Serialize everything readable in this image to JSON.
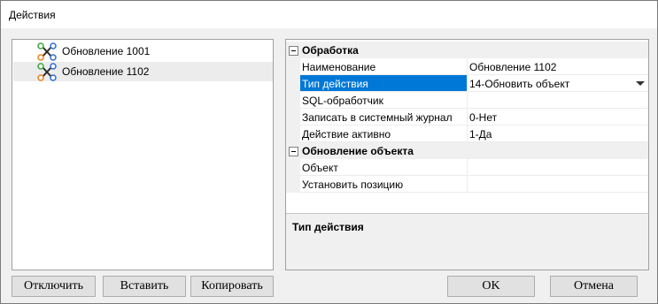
{
  "window": {
    "title": "Действия"
  },
  "tree": {
    "items": [
      {
        "label": "Обновление 1001",
        "selected": false
      },
      {
        "label": "Обновление 1102",
        "selected": true
      }
    ]
  },
  "props": {
    "categories": [
      {
        "title": "Обработка",
        "rows": [
          {
            "name": "Наименование",
            "value": "Обновление 1102"
          },
          {
            "name": "Тип действия",
            "value": "14-Обновить объект",
            "selected": true,
            "dropdown": true
          },
          {
            "name": "SQL-обработчик",
            "value": ""
          },
          {
            "name": "Записать в системный журнал",
            "value": "0-Нет"
          },
          {
            "name": "Действие активно",
            "value": "1-Да"
          }
        ]
      },
      {
        "title": "Обновление объекта",
        "rows": [
          {
            "name": "Объект",
            "value": ""
          },
          {
            "name": "Установить позицию",
            "value": ""
          }
        ]
      }
    ],
    "description_title": "Тип действия"
  },
  "buttons": {
    "disable": "Отключить",
    "insert": "Вставить",
    "copy": "Копировать",
    "ok": "OK",
    "cancel": "Отмена"
  },
  "colors": {
    "selection": "#0078d7",
    "icon_blue": "#2f6fd0",
    "icon_orange": "#e8821e",
    "icon_green": "#3aa63a"
  }
}
